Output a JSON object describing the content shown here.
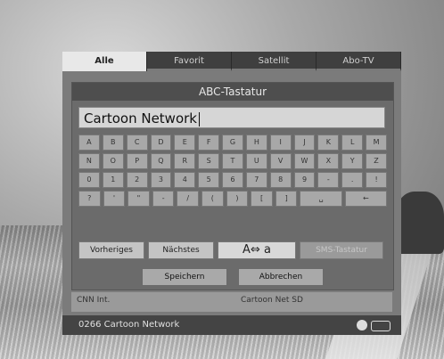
{
  "tabs": [
    "Alle",
    "Favorit",
    "Satellit",
    "Abo-TV"
  ],
  "dialog_title": "ABC-Tastatur",
  "input_value": "Cartoon Network",
  "keyboard_rows": [
    [
      "A",
      "B",
      "C",
      "D",
      "E",
      "F",
      "G",
      "H",
      "I",
      "J",
      "K",
      "L",
      "M"
    ],
    [
      "N",
      "O",
      "P",
      "Q",
      "R",
      "S",
      "T",
      "U",
      "V",
      "W",
      "X",
      "Y",
      "Z"
    ],
    [
      "0",
      "1",
      "2",
      "3",
      "4",
      "5",
      "6",
      "7",
      "8",
      "9",
      "-",
      ".",
      "!"
    ],
    [
      "?",
      "'",
      "\"",
      "-",
      "/",
      "(",
      ")",
      "[",
      "]",
      "␣",
      "←"
    ]
  ],
  "function_buttons": {
    "previous": "Vorheriges",
    "next": "Nächstes",
    "case": "A⇔ a",
    "sms": "SMS-Tastatur"
  },
  "buttons": {
    "save": "Speichern",
    "cancel": "Abbrechen"
  },
  "underlying": {
    "left": "CNN Int.",
    "right": "Cartoon Net SD"
  },
  "status": {
    "channel": "0266  Cartoon Network"
  }
}
